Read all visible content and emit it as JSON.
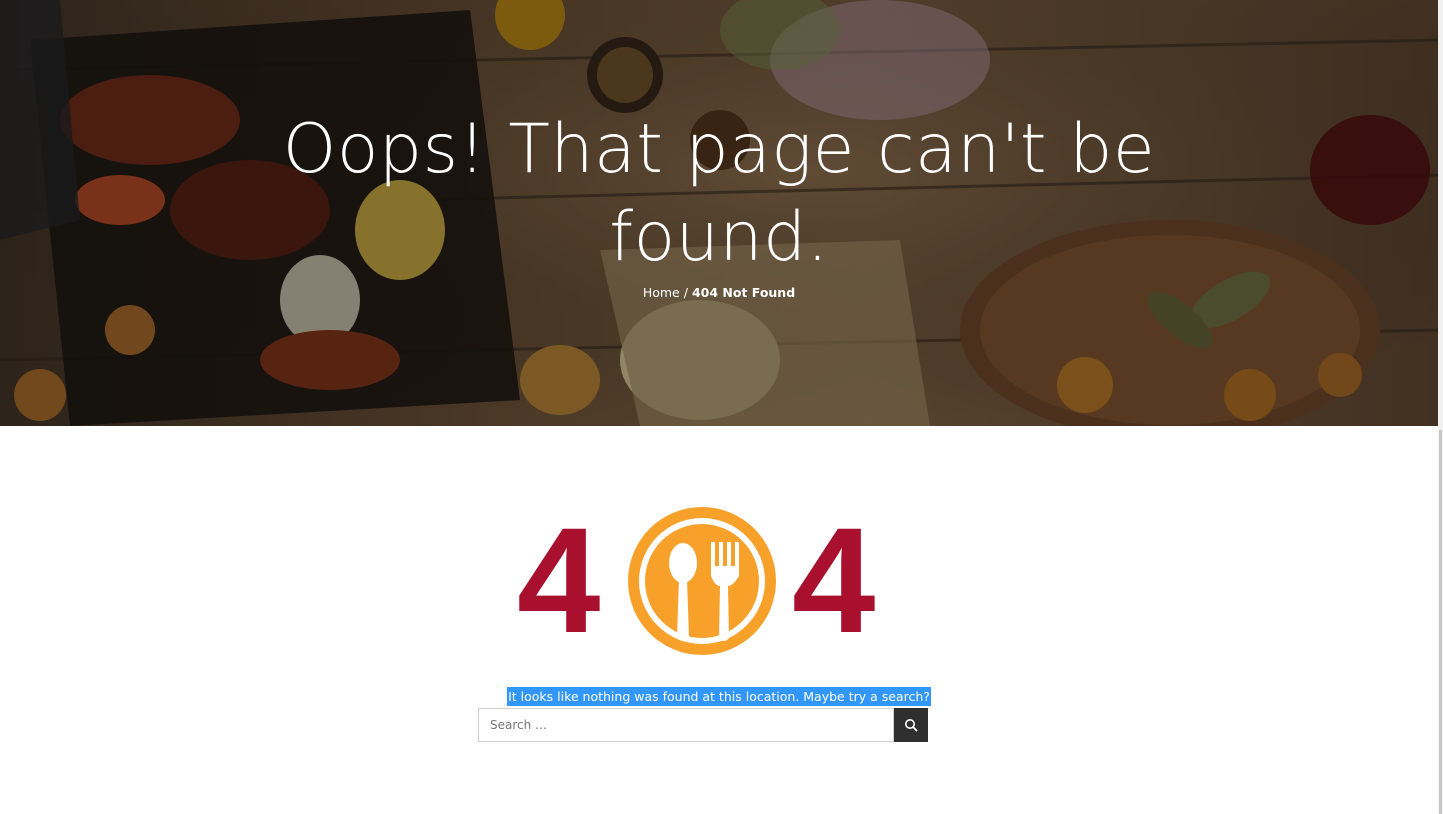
{
  "hero": {
    "title": "Oops! That page can't be found.",
    "breadcrumb": {
      "home_label": "Home",
      "separator": "/",
      "current_label": "404 Not Found"
    }
  },
  "error_graphic": {
    "left_digit": "4",
    "right_digit": "4",
    "icon": "plate-spoon-fork-icon",
    "digit_color": "#a8102e",
    "icon_color": "#f7a12a"
  },
  "message": "It looks like nothing was found at this location. Maybe try a search?",
  "search": {
    "placeholder": "Search …",
    "value": "",
    "button_icon": "search-icon",
    "button_color": "#2f2f2f"
  }
}
